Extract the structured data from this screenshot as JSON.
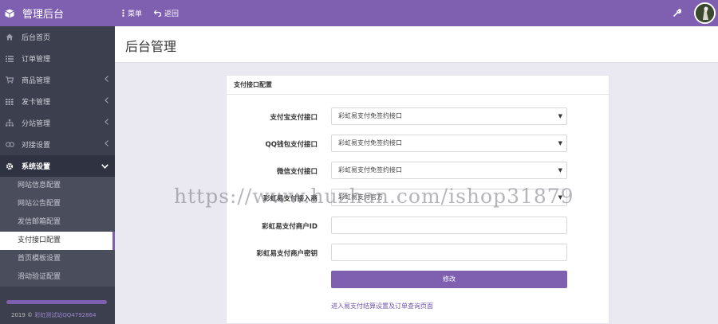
{
  "app": {
    "title": "管理后台"
  },
  "topbar": {
    "menu_label": "菜单",
    "back_label": "返回"
  },
  "sidebar": {
    "items": [
      {
        "label": "后台首页",
        "icon": "home-icon"
      },
      {
        "label": "订单管理",
        "icon": "list-icon"
      },
      {
        "label": "商品管理",
        "icon": "cart-icon"
      },
      {
        "label": "发卡管理",
        "icon": "grid-icon"
      },
      {
        "label": "分站管理",
        "icon": "sitemap-icon"
      },
      {
        "label": "对接设置",
        "icon": "link-icon"
      },
      {
        "label": "系统设置",
        "icon": "gear-icon"
      }
    ],
    "sub_items": [
      "网站信息配置",
      "网站公告配置",
      "发信邮箱配置",
      "支付接口配置",
      "首页模板设置",
      "滑动验证配置"
    ],
    "footer": {
      "year": "2019 ©",
      "link": "彩虹测试站QQ4792864"
    }
  },
  "page": {
    "title": "后台管理"
  },
  "panel": {
    "title": "支付接口配置",
    "fields": [
      {
        "label": "支付宝支付接口",
        "value": "彩虹易支付免签约接口"
      },
      {
        "label": "QQ钱包支付接口",
        "value": "彩虹易支付免签约接口"
      },
      {
        "label": "微信支付接口",
        "value": "彩虹易支付免签约接口"
      },
      {
        "label": "彩虹易支付接入商",
        "value": "彩虹易支付官方"
      },
      {
        "label": "彩虹易支付商户ID",
        "value": ""
      },
      {
        "label": "彩虹易支付商户密钥",
        "value": ""
      }
    ],
    "submit_label": "修改",
    "bottom_link": "进入易支付结算设置及订单查询页面"
  },
  "watermark": "https://www.huzhan.com/ishop31879",
  "colors": {
    "accent": "#7e5fb0",
    "sidebar": "#3c3f4e"
  }
}
